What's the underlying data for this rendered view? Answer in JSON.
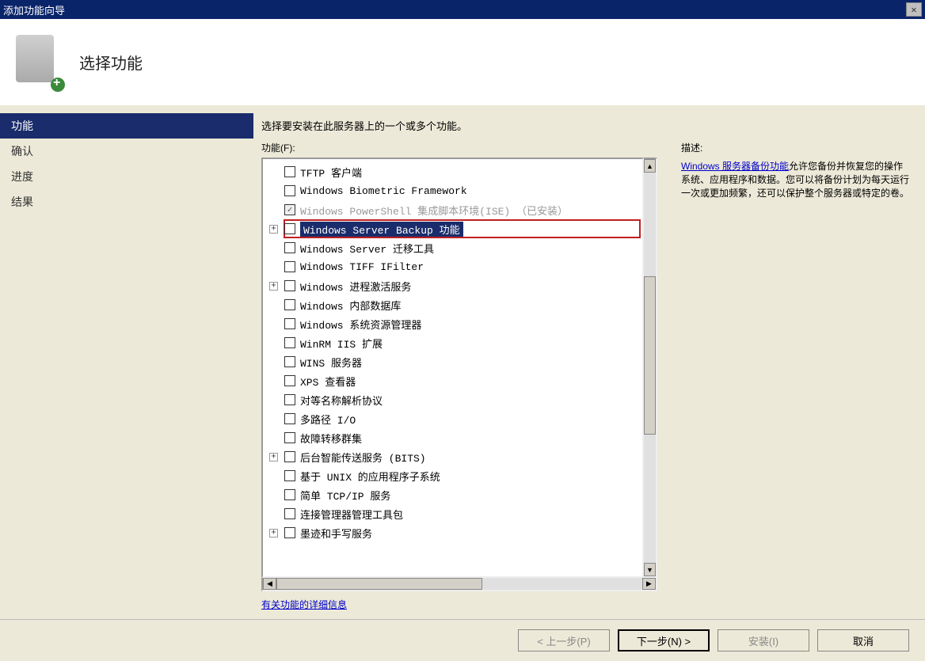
{
  "window": {
    "title": "添加功能向导"
  },
  "header": {
    "title": "选择功能"
  },
  "sidebar": {
    "items": [
      {
        "label": "功能",
        "active": true
      },
      {
        "label": "确认"
      },
      {
        "label": "进度"
      },
      {
        "label": "结果"
      }
    ]
  },
  "content": {
    "prompt": "选择要安装在此服务器上的一个或多个功能。",
    "features_label": "功能(F):",
    "tree": [
      {
        "label": "TFTP 客户端"
      },
      {
        "label": "Windows Biometric Framework"
      },
      {
        "label": "Windows PowerShell 集成脚本环境(ISE)",
        "suffix": "（已安装）",
        "disabled": true,
        "checked": true
      },
      {
        "label": "Windows Server Backup 功能",
        "expandable": true,
        "highlight": true,
        "selected": true
      },
      {
        "label": "Windows Server 迁移工具"
      },
      {
        "label": "Windows TIFF IFilter"
      },
      {
        "label": "Windows 进程激活服务",
        "expandable": true
      },
      {
        "label": "Windows 内部数据库"
      },
      {
        "label": "Windows 系统资源管理器"
      },
      {
        "label": "WinRM IIS 扩展"
      },
      {
        "label": "WINS 服务器"
      },
      {
        "label": "XPS 查看器"
      },
      {
        "label": "对等名称解析协议"
      },
      {
        "label": "多路径 I/O"
      },
      {
        "label": "故障转移群集"
      },
      {
        "label": "后台智能传送服务 (BITS)",
        "expandable": true
      },
      {
        "label": "基于 UNIX 的应用程序子系统"
      },
      {
        "label": "简单 TCP/IP 服务"
      },
      {
        "label": "连接管理器管理工具包"
      },
      {
        "label": "墨迹和手写服务",
        "expandable": true
      }
    ],
    "detail_link": "有关功能的详细信息"
  },
  "description": {
    "label": "描述:",
    "link_text": "Windows 服务器备份功能",
    "text_rest": "允许您备份并恢复您的操作系统、应用程序和数据。您可以将备份计划为每天运行一次或更加频繁，还可以保护整个服务器或特定的卷。"
  },
  "buttons": {
    "prev": "< 上一步(P)",
    "next": "下一步(N) >",
    "install": "安装(I)",
    "cancel": "取消"
  }
}
